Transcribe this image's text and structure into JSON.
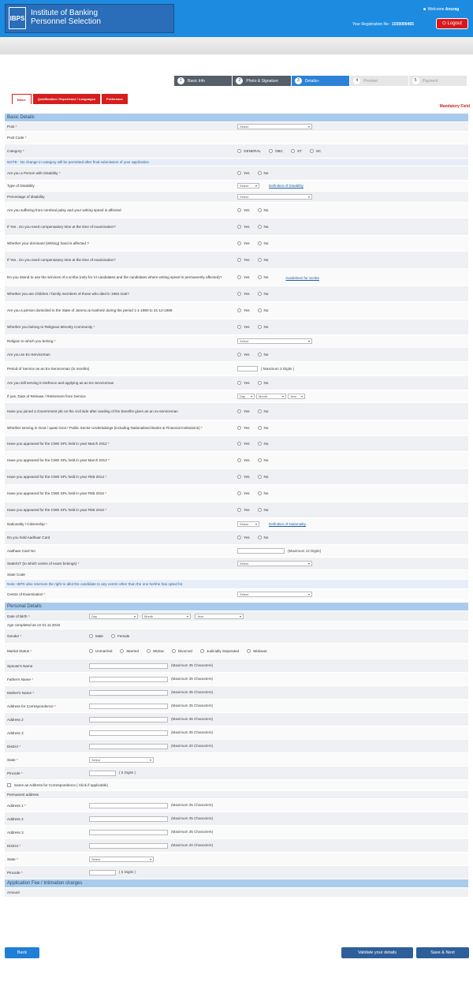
{
  "header": {
    "logo_badge": "IBPS",
    "title1": "Institute of Banking",
    "title2": "Personnel Selection",
    "welcome": "Welcome",
    "user": "Anurag",
    "reg_label": "Your Registration No :",
    "reg_no": "1030009465",
    "logout": "Logout"
  },
  "steps": [
    {
      "n": "1",
      "label": "Basic Info"
    },
    {
      "n": "2",
      "label": "Photo & Signature"
    },
    {
      "n": "3",
      "label": "Details"
    },
    {
      "n": "4",
      "label": "Preview"
    },
    {
      "n": "5",
      "label": "Payment"
    }
  ],
  "tabs": [
    "Basic",
    "Qualification / Experience / Languages",
    "Preference"
  ],
  "mandatory": "Mandatory Field",
  "sections": {
    "basic": "Basic Details",
    "personal": "Personal Details",
    "fee": "Application Fee / Intimation charges"
  },
  "basic_rows": [
    {
      "q": "Post",
      "req": true,
      "ctrl": "select",
      "val": "Select"
    },
    {
      "q": "Post Code",
      "req": true,
      "ctrl": "none"
    },
    {
      "q": "Category",
      "req": true,
      "ctrl": "radio",
      "opts": [
        "GENERAL",
        "OBC",
        "ST",
        "SC"
      ]
    },
    {
      "q": "NOTE : No change in category will be permitted after final submission of your application",
      "ctrl": "note"
    },
    {
      "q": "Are you a Person with Disability",
      "req": true,
      "ctrl": "yn"
    },
    {
      "q": "Type of Disability",
      "ctrl": "selectlink",
      "val": "Select",
      "link": "Definition of Disability"
    },
    {
      "q": "Percentage of disability",
      "ctrl": "select",
      "val": "Select"
    },
    {
      "q": "Are you suffering from cerebral palsy and your writing speed is affected",
      "ctrl": "yn"
    },
    {
      "q": "If Yes , Do you need compensatory time at the time of examination?",
      "ctrl": "yn"
    },
    {
      "q": "Whether your dominant (Writing) hand is affected ?",
      "ctrl": "yn"
    },
    {
      "q": "If Yes , Do you need compensatory time at the time of examination?",
      "ctrl": "yn"
    },
    {
      "q": "Do you intend to use the services of a scribe (only for VI candidates and the candidates where writing speed is permanently affected)?",
      "ctrl": "ynlink",
      "link": "Guidelines for Scribe"
    },
    {
      "q": "Whether you are Children / family members of those who died in 1984 riots?",
      "ctrl": "yn"
    },
    {
      "q": "Are you a person domiciled in the State of Jammu & Kashmir during the period 1-1-1980 to 31-12-1989",
      "ctrl": "yn"
    },
    {
      "q": "Whether you belong to Religious Minority Community",
      "req": true,
      "ctrl": "yn"
    },
    {
      "q": "Religion to which you belong",
      "req": true,
      "ctrl": "select",
      "val": "Select"
    },
    {
      "q": "Are you an Ex-Serviceman",
      "ctrl": "yn"
    },
    {
      "q": "Period of Service as an Ex-Serviceman (in months)",
      "ctrl": "inputhint",
      "hint": "( Maximum 3 Digits )"
    },
    {
      "q": "Are you still serving in Defence and applying as an Ex-Serviceman",
      "ctrl": "yn"
    },
    {
      "q": "If yes, Date of Release / Retirement from Service",
      "ctrl": "date",
      "vals": [
        "Day",
        "Month",
        "Year"
      ]
    },
    {
      "q": "Have you joined a Government job on the civil side after availing of the benefits given as an ex-serviceman",
      "ctrl": "yn"
    },
    {
      "q": "Whether serving in Govt / quasi Govt / Public Sector Undertakings (including Nationalised Banks & Financial Institutions)",
      "req": true,
      "ctrl": "yn"
    },
    {
      "q": "Have you appeared for the CWE SPL held in year March 2012",
      "req": true,
      "ctrl": "yn"
    },
    {
      "q": "Have you appeared for the CWE SPL held in year March 2013",
      "req": true,
      "ctrl": "yn"
    },
    {
      "q": "Have you appeared for the CWE SPL held in year FEB 2014",
      "req": true,
      "ctrl": "yn"
    },
    {
      "q": "Have you appeared for the CWE SPL held in year FEB 2015",
      "req": true,
      "ctrl": "yn"
    },
    {
      "q": "Have you appeared for the CWE SPL held in year FEB 2016",
      "req": true,
      "ctrl": "yn"
    },
    {
      "q": "Nationality / Citizenship",
      "req": true,
      "ctrl": "selectlink",
      "val": "Select",
      "link": "Definition of Nationality"
    },
    {
      "q": "Do you hold Aadhaar Card",
      "ctrl": "yn"
    },
    {
      "q": "Aadhaar Card No",
      "ctrl": "inputhint",
      "hint": "(Maximum 12 Digits)"
    },
    {
      "q": "State/UT (to which centre of exam belongs)",
      "req": true,
      "ctrl": "select",
      "val": "Select"
    },
    {
      "q": "State Code",
      "ctrl": "none"
    },
    {
      "q": "Note: IBPS also reserves the right to allot the candidate to any centre other than the one he/she has opted for.",
      "ctrl": "note"
    },
    {
      "q": "Centre of Examination",
      "req": true,
      "ctrl": "select",
      "val": "Select"
    }
  ],
  "personal_rows": [
    {
      "q": "Date of Birth",
      "req": true,
      "ctrl": "dob",
      "vals": [
        "Day",
        "Month",
        "Year"
      ]
    },
    {
      "q": "Age completed as on 01.11.2016",
      "ctrl": "none"
    },
    {
      "q": "Gender",
      "req": true,
      "ctrl": "radio",
      "opts": [
        "Male",
        "Female"
      ]
    },
    {
      "q": "Marital Status",
      "req": true,
      "ctrl": "radio",
      "opts": [
        "Unmarried",
        "Married",
        "Widow",
        "Divorced",
        "Judicially Separated",
        "Widower"
      ]
    },
    {
      "q": "Spouse's Name",
      "ctrl": "text",
      "hint": "(Maximum 35 Characters)"
    },
    {
      "q": "Father's Name",
      "req": true,
      "ctrl": "text",
      "hint": "(Maximum 35 Characters)"
    },
    {
      "q": "Mother's Name",
      "req": true,
      "ctrl": "text",
      "hint": "(Maximum 35 Characters)"
    },
    {
      "q": "Address for Correspondence",
      "req": true,
      "ctrl": "text",
      "hint": "(Maximum 35 Characters)"
    },
    {
      "q": "Address 2",
      "ctrl": "text",
      "hint": "(Maximum 35 Characters)"
    },
    {
      "q": "Address 3",
      "ctrl": "text",
      "hint": "(Maximum 35 Characters)"
    },
    {
      "q": "District",
      "req": true,
      "ctrl": "text",
      "hint": "(Maximum 20 Characters)"
    },
    {
      "q": "State",
      "req": true,
      "ctrl": "select",
      "val": "Select"
    },
    {
      "q": "Pincode",
      "req": true,
      "ctrl": "pin",
      "hint": "( 6 Digits )"
    },
    {
      "q": "Same as Address for Correspondence ( Click if applicable)",
      "ctrl": "check"
    },
    {
      "q": "Permanent address",
      "ctrl": "none"
    },
    {
      "q": "Address 1",
      "req": true,
      "ctrl": "text",
      "hint": "(Maximum 35 Characters)"
    },
    {
      "q": "Address 2",
      "ctrl": "text",
      "hint": "(Maximum 35 Characters)"
    },
    {
      "q": "Address 3",
      "ctrl": "text",
      "hint": "(Maximum 35 Characters)"
    },
    {
      "q": "District",
      "req": true,
      "ctrl": "text",
      "hint": "(Maximum 20 Characters)"
    },
    {
      "q": "State",
      "req": true,
      "ctrl": "select",
      "val": "Select"
    },
    {
      "q": "Pincode",
      "req": true,
      "ctrl": "pin",
      "hint": "( 6 Digits )"
    }
  ],
  "fee_rows": [
    {
      "q": "Amount",
      "ctrl": "none"
    }
  ],
  "yn": [
    "Yes",
    "No"
  ],
  "buttons": {
    "back": "Back",
    "validate": "Validate your details",
    "save_next": "Save & Next"
  }
}
